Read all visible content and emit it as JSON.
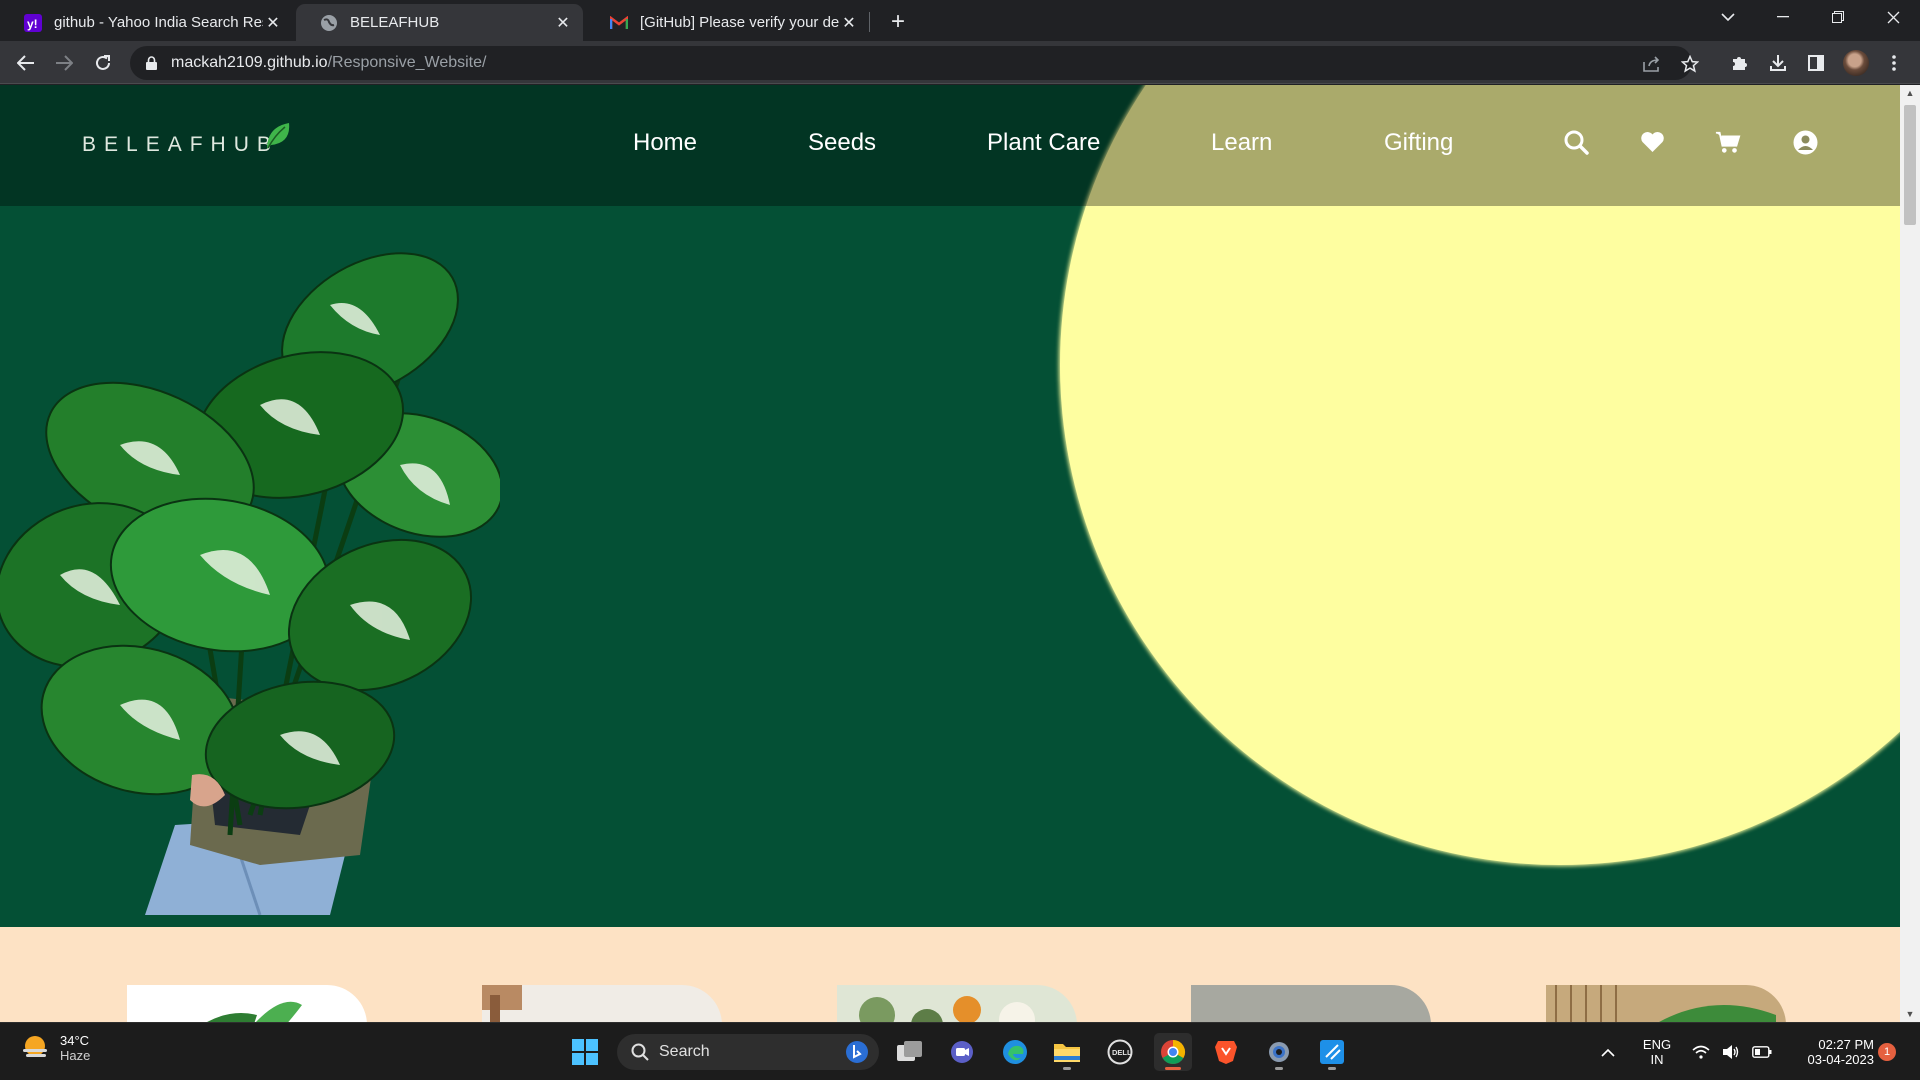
{
  "browser": {
    "tabs": [
      {
        "title": "github - Yahoo India Search Resu",
        "favicon": "yahoo-icon",
        "active": false
      },
      {
        "title": "BELEAFHUB",
        "favicon": "globe-icon",
        "active": true
      },
      {
        "title": "[GitHub] Please verify your devic",
        "favicon": "gmail-icon",
        "active": false
      }
    ],
    "url_host": "mackah2109.github.io",
    "url_path": "/Responsive_Website/"
  },
  "site": {
    "logo_text": "BELEAFHUB",
    "nav": [
      "Home",
      "Seeds",
      "Plant Care",
      "Learn",
      "Gifting"
    ],
    "nav_icons": [
      "search-icon",
      "heart-icon",
      "cart-icon",
      "user-icon"
    ],
    "colors": {
      "background": "#045035",
      "sun": "#fefea0",
      "cream": "#fde2c4",
      "nav_text": "#ffffff"
    }
  },
  "taskbar": {
    "weather_temp": "34°C",
    "weather_cond": "Haze",
    "search_label": "Search",
    "lang_top": "ENG",
    "lang_bottom": "IN",
    "time": "02:27 PM",
    "date": "03-04-2023",
    "notification_count": "1"
  }
}
